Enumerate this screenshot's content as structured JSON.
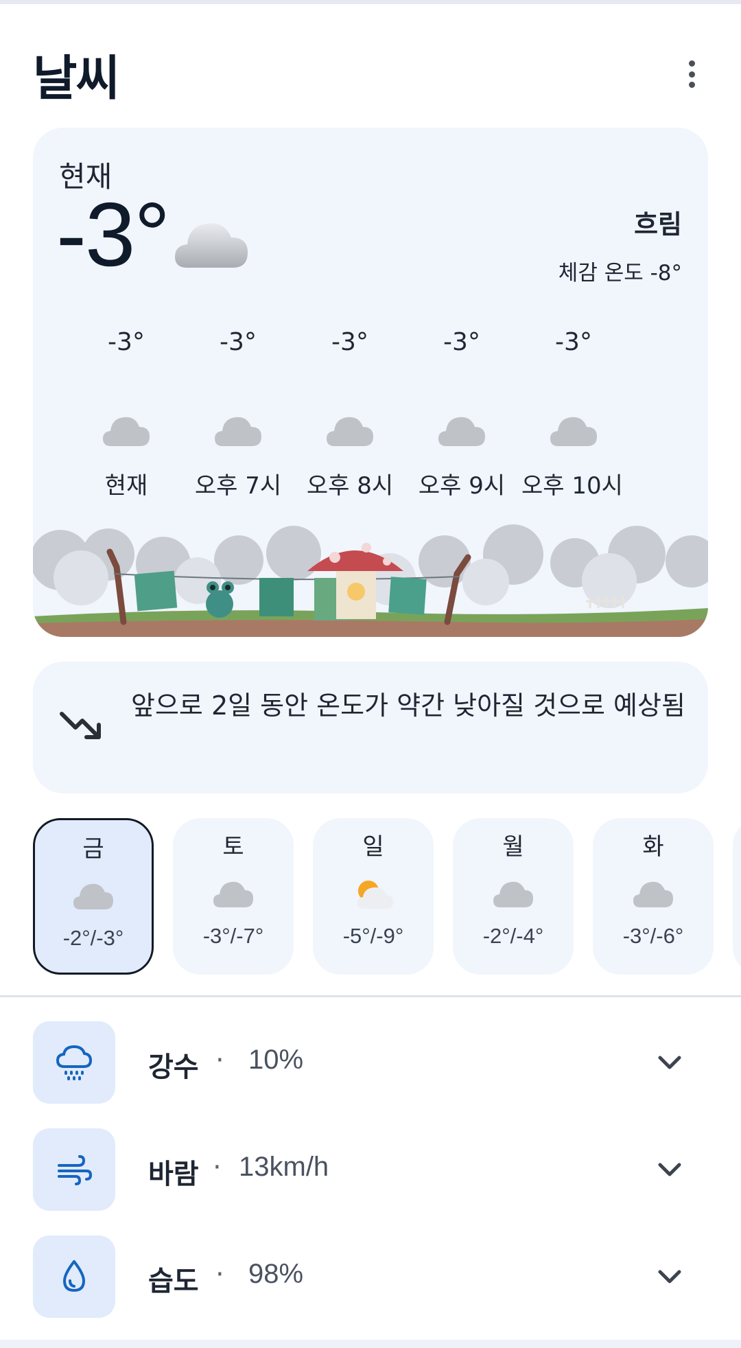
{
  "header": {
    "title": "날씨",
    "menu_icon": "more-vertical-icon"
  },
  "current": {
    "label": "현재",
    "temperature": "-3°",
    "condition": "흐림",
    "feels_like": "체감 온도 -8°",
    "icon": "cloud-icon"
  },
  "hourly": [
    {
      "temp": "-3°",
      "label": "현재",
      "icon": "cloud-icon"
    },
    {
      "temp": "-3°",
      "label": "오후 7시",
      "icon": "cloud-icon"
    },
    {
      "temp": "-3°",
      "label": "오후 8시",
      "icon": "cloud-icon"
    },
    {
      "temp": "-3°",
      "label": "오후 9시",
      "icon": "cloud-icon"
    },
    {
      "temp": "-3°",
      "label": "오후 10시",
      "icon": "cloud-icon"
    }
  ],
  "insight": {
    "icon": "trending-down-icon",
    "text": "앞으로 2일 동안 온도가 약간 낮아질 것으로 예상됨"
  },
  "daily": [
    {
      "day": "금",
      "range": "-2°/-3°",
      "icon": "cloud-icon",
      "selected": true
    },
    {
      "day": "토",
      "range": "-3°/-7°",
      "icon": "cloud-icon"
    },
    {
      "day": "일",
      "range": "-5°/-9°",
      "icon": "partly-sunny-icon"
    },
    {
      "day": "월",
      "range": "-2°/-4°",
      "icon": "cloud-icon"
    },
    {
      "day": "화",
      "range": "-3°/-6°",
      "icon": "cloud-icon"
    }
  ],
  "details": [
    {
      "label": "강수",
      "value": "10%",
      "icon": "rain-cloud-icon"
    },
    {
      "label": "바람",
      "value": "13km/h",
      "icon": "wind-icon"
    },
    {
      "label": "습도",
      "value": "98%",
      "icon": "water-drop-icon"
    }
  ],
  "colors": {
    "card_bg": "#f1f5fc",
    "icon_box_bg": "#e1ebfb",
    "accent_blue": "#1565c0",
    "text_dark": "#0f1a2a"
  }
}
